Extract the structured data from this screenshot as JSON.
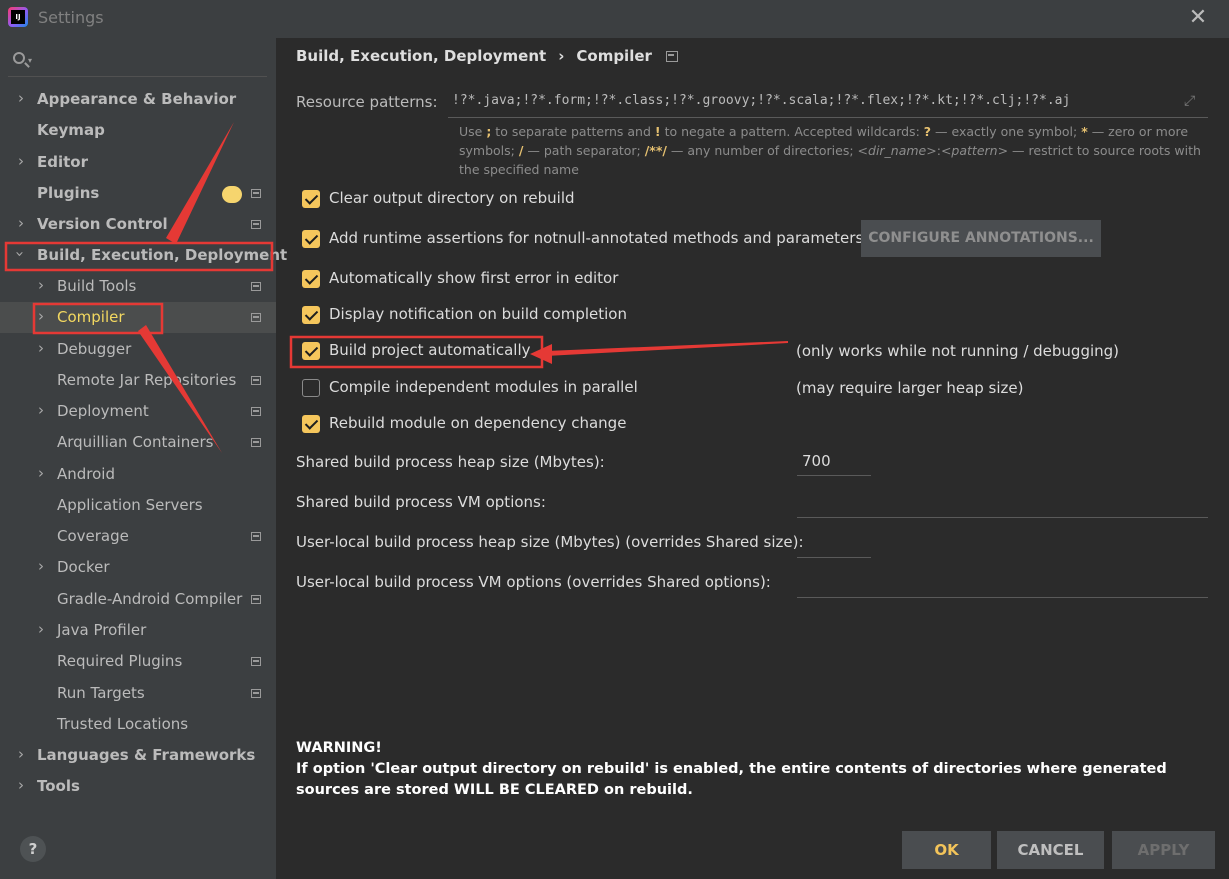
{
  "window": {
    "title": "Settings",
    "app_icon_text": "IJ"
  },
  "sidebar": {
    "items": [
      {
        "label": "Appearance & Behavior",
        "level": "top",
        "expandable": true
      },
      {
        "label": "Keymap",
        "level": "top",
        "expandable": false
      },
      {
        "label": "Editor",
        "level": "top",
        "expandable": true
      },
      {
        "label": "Plugins",
        "level": "top",
        "expandable": false
      },
      {
        "label": "Version Control",
        "level": "top",
        "expandable": true
      },
      {
        "label": "Build, Execution, Deployment",
        "level": "top",
        "expandable": true,
        "expanded": true
      },
      {
        "label": "Build Tools",
        "level": "child",
        "expandable": true
      },
      {
        "label": "Compiler",
        "level": "child",
        "expandable": true,
        "selected": true
      },
      {
        "label": "Debugger",
        "level": "child",
        "expandable": true
      },
      {
        "label": "Remote Jar Repositories",
        "level": "child",
        "expandable": false
      },
      {
        "label": "Deployment",
        "level": "child",
        "expandable": true
      },
      {
        "label": "Arquillian Containers",
        "level": "child",
        "expandable": false
      },
      {
        "label": "Android",
        "level": "child",
        "expandable": true
      },
      {
        "label": "Application Servers",
        "level": "child",
        "expandable": false
      },
      {
        "label": "Coverage",
        "level": "child",
        "expandable": false
      },
      {
        "label": "Docker",
        "level": "child",
        "expandable": true
      },
      {
        "label": "Gradle-Android Compiler",
        "level": "child",
        "expandable": false
      },
      {
        "label": "Java Profiler",
        "level": "child",
        "expandable": true
      },
      {
        "label": "Required Plugins",
        "level": "child",
        "expandable": false
      },
      {
        "label": "Run Targets",
        "level": "child",
        "expandable": false
      },
      {
        "label": "Trusted Locations",
        "level": "child",
        "expandable": false
      },
      {
        "label": "Languages & Frameworks",
        "level": "top",
        "expandable": true
      },
      {
        "label": "Tools",
        "level": "top",
        "expandable": true
      }
    ],
    "help_label": "?"
  },
  "breadcrumb": {
    "parent": "Build, Execution, Deployment",
    "separator": "›",
    "current": "Compiler"
  },
  "resource_patterns": {
    "label": "Resource patterns:",
    "value": "!?*.java;!?*.form;!?*.class;!?*.groovy;!?*.scala;!?*.flex;!?*.kt;!?*.clj;!?*.aj"
  },
  "hint": {
    "t1": "Use ",
    "semicolon": ";",
    "t2": " to separate patterns and ",
    "bang": "!",
    "t3": " to negate a pattern. Accepted wildcards: ",
    "q": "?",
    "t4": " — exactly one symbol; ",
    "star": "*",
    "t5": " — zero or more symbols; ",
    "slash": "/",
    "t6": " — path separator; ",
    "dstar": "/**/",
    "t7": " — any number of directories; ",
    "dir": "<dir_name>",
    "colon": ":",
    "pattern": "<pattern>",
    "t8": " — restrict to source roots with the specified name"
  },
  "options": [
    {
      "label": "Clear output directory on rebuild",
      "checked": true
    },
    {
      "label": "Add runtime assertions for notnull-annotated methods and parameters",
      "checked": true
    },
    {
      "label": "Automatically show first error in editor",
      "checked": true
    },
    {
      "label": "Display notification on build completion",
      "checked": true
    },
    {
      "label": "Build project automatically",
      "checked": true
    },
    {
      "label": "Compile independent modules in parallel",
      "checked": false
    },
    {
      "label": "Rebuild module on dependency change",
      "checked": true
    }
  ],
  "notes": {
    "build_auto": "(only works while not running / debugging)",
    "parallel": "(may require larger heap size)"
  },
  "configure_button": "CONFIGURE ANNOTATIONS...",
  "fields": {
    "heap_label": "Shared build process heap size (Mbytes):",
    "heap_value": "700",
    "vm_label": "Shared build process VM options:",
    "vm_value": "",
    "local_heap_label": "User-local build process heap size (Mbytes) (overrides Shared size):",
    "local_heap_value": "",
    "local_vm_label": "User-local build process VM options (overrides Shared options):",
    "local_vm_value": ""
  },
  "warning": {
    "title": "WARNING!",
    "body": "If option 'Clear output directory on rebuild' is enabled, the entire contents of directories where generated sources are stored WILL BE CLEARED on rebuild."
  },
  "buttons": {
    "ok": "OK",
    "cancel": "CANCEL",
    "apply": "APPLY"
  },
  "colors": {
    "accent": "#f5c65c",
    "annotation": "#e53935",
    "background": "#2b2b2b",
    "sidebar": "#3c3f41"
  }
}
